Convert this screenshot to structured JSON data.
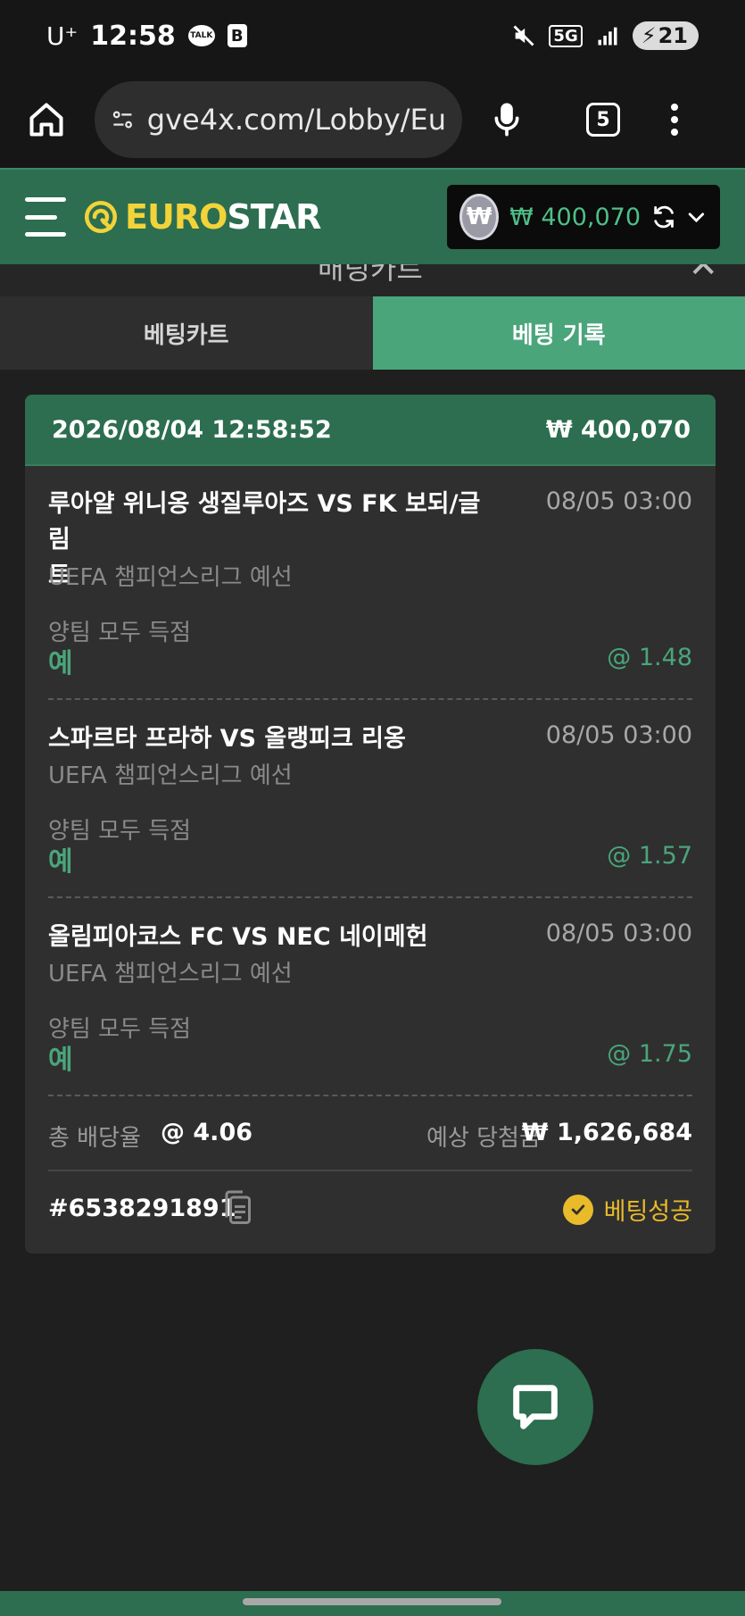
{
  "status_bar": {
    "carrier": "U⁺",
    "time": "12:58",
    "talk_badge": "TALK",
    "b_badge": "B",
    "network": "5G",
    "battery": "21"
  },
  "browser": {
    "url": "gve4x.com/Lobby/Eu",
    "tab_count": "5"
  },
  "header": {
    "logo_euro": "EURO",
    "logo_star": "STAR",
    "currency_symbol": "₩",
    "balance": "₩ 400,070"
  },
  "panel": {
    "title": "배팅카트"
  },
  "tabs": [
    {
      "label": "베팅카트",
      "active": false
    },
    {
      "label": "베팅 기록",
      "active": true
    }
  ],
  "bet_record": {
    "datetime": "2026/08/04 12:58:52",
    "stake": "₩ 400,070",
    "selections": [
      {
        "match_line1": "루아얄 위니옹 생질루아즈 VS FK 보되/글림",
        "match_line2": "트",
        "kickoff": "08/05 03:00",
        "league": "UEFA 챔피언스리그 예선",
        "market": "양팀 모두 득점",
        "pick": "예",
        "odds": "@ 1.48"
      },
      {
        "match_line1": "스파르타 프라하 VS 올랭피크 리옹",
        "match_line2": "",
        "kickoff": "08/05 03:00",
        "league": "UEFA 챔피언스리그 예선",
        "market": "양팀 모두 득점",
        "pick": "예",
        "odds": "@ 1.57"
      },
      {
        "match_line1": "올림피아코스 FC VS NEC 네이메헌",
        "match_line2": "",
        "kickoff": "08/05 03:00",
        "league": "UEFA 챔피언스리그 예선",
        "market": "양팀 모두 득점",
        "pick": "예",
        "odds": "@ 1.75"
      }
    ],
    "total_odds_label": "총 배당율",
    "total_odds": "@ 4.06",
    "expected_win_label": "예상 당첨금",
    "expected_win": "₩ 1,626,684",
    "ticket_id": "#6538291891",
    "status": "베팅성공"
  },
  "colors": {
    "brand_green": "#2c6e4f",
    "active_tab": "#4aa57b",
    "logo_yellow": "#f2d33a",
    "success_yellow": "#e9bb2a",
    "odds_green": "#4aa57b"
  }
}
